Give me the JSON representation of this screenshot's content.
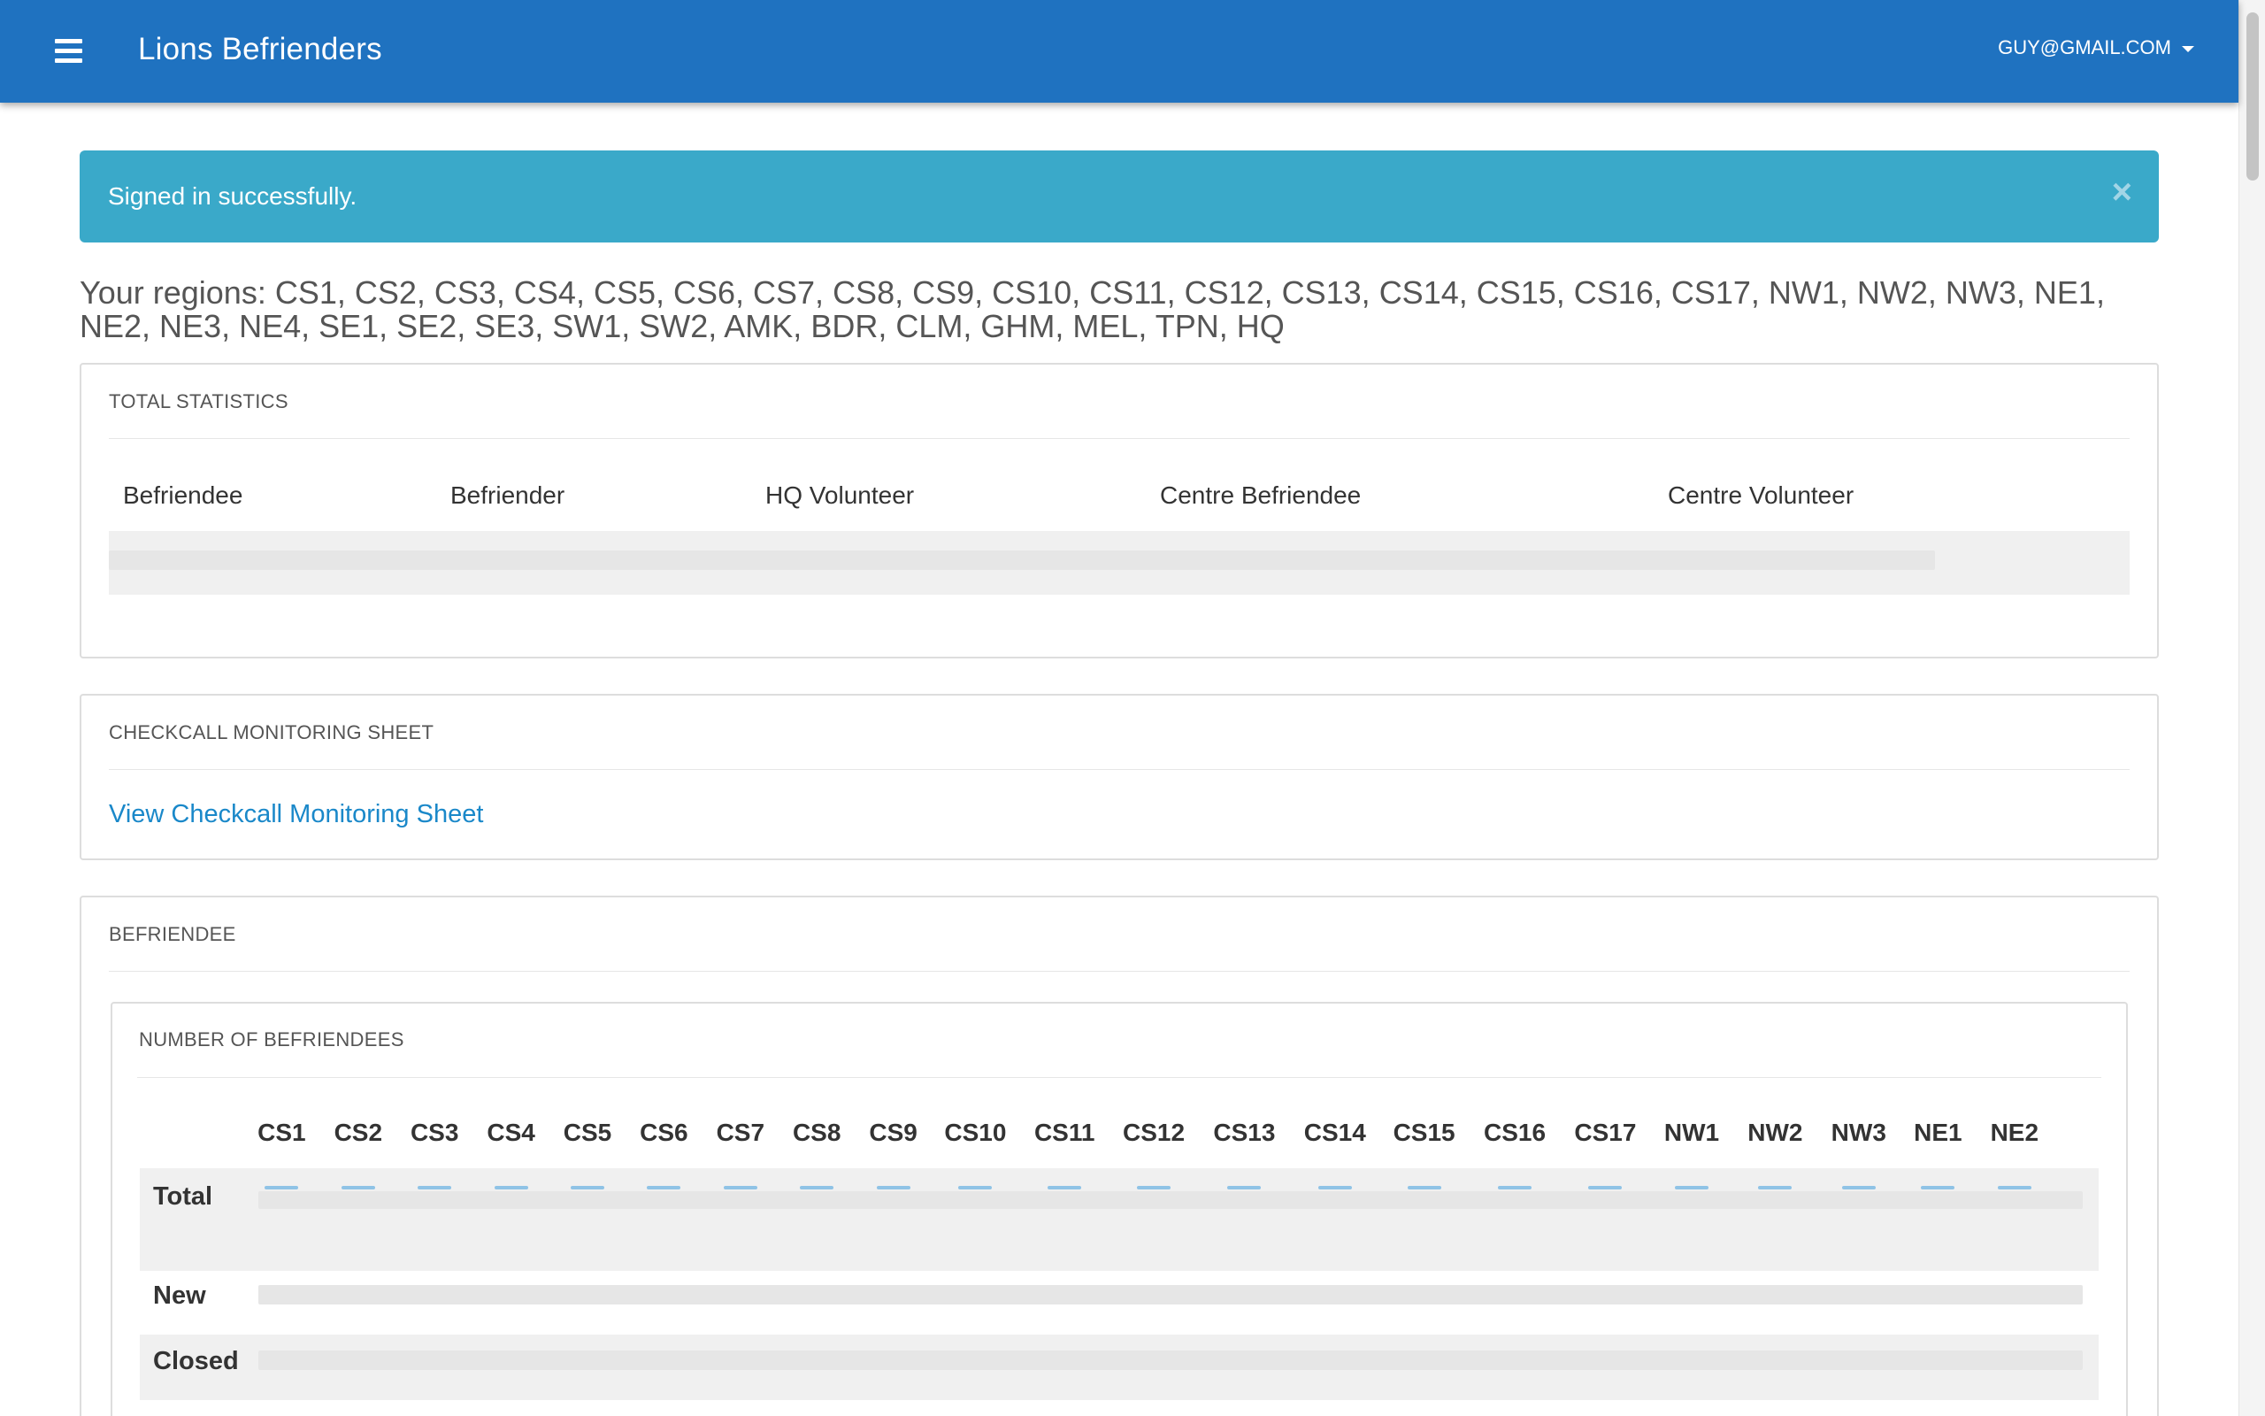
{
  "navbar": {
    "brand": "Lions Befrienders",
    "user_email": "GUY@GMAIL.COM",
    "menu_icon": "hamburger-icon",
    "caret_icon": "caret-down-icon",
    "color": "#1f72c0"
  },
  "alert": {
    "message": "Signed in successfully.",
    "close_symbol": "×",
    "color": "#3aa9c9"
  },
  "regions_text": "Your regions: CS1, CS2, CS3, CS4, CS5, CS6, CS7, CS8, CS9, CS10, CS11, CS12, CS13, CS14, CS15, CS16, CS17, NW1, NW2, NW3, NE1, NE2, NE3, NE4, SE1, SE2, SE3, SW1, SW2, AMK, BDR, CLM, GHM, MEL, TPN, HQ",
  "total_statistics": {
    "title": "TOTAL STATISTICS",
    "columns": [
      "Befriendee",
      "Befriender",
      "HQ Volunteer",
      "Centre Befriendee",
      "Centre Volunteer"
    ]
  },
  "checkcall": {
    "title": "CHECKCALL MONITORING SHEET",
    "link_label": "View Checkcall Monitoring Sheet",
    "link_color": "#1a88c9"
  },
  "befriendee": {
    "title": "BEFRIENDEE",
    "number_title": "NUMBER OF BEFRIENDEES",
    "columns": [
      "CS1",
      "CS2",
      "CS3",
      "CS4",
      "CS5",
      "CS6",
      "CS7",
      "CS8",
      "CS9",
      "CS10",
      "CS11",
      "CS12",
      "CS13",
      "CS14",
      "CS15",
      "CS16",
      "CS17",
      "NW1",
      "NW2",
      "NW3",
      "NE1",
      "NE2"
    ],
    "rows": [
      "Total",
      "New",
      "Closed"
    ]
  }
}
